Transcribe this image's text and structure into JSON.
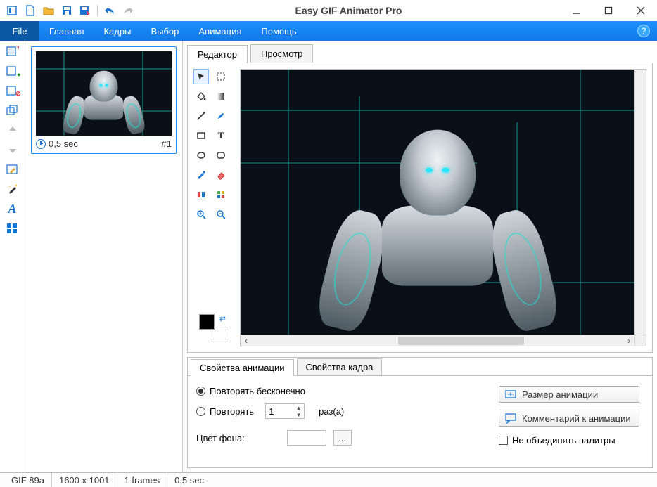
{
  "title": "Easy GIF Animator Pro",
  "ribbon": {
    "file": "File",
    "tabs": [
      "Главная",
      "Кадры",
      "Выбор",
      "Анимация",
      "Помощь"
    ],
    "help_glyph": "?"
  },
  "frames_panel": {
    "frame0": {
      "duration": "0,5 sec",
      "index": "#1"
    }
  },
  "editor": {
    "tabs": {
      "editor": "Редактор",
      "preview": "Просмотр"
    }
  },
  "props": {
    "tabs": {
      "anim": "Свойства анимации",
      "frame": "Свойства кадра"
    },
    "repeat_forever": "Повторять бесконечно",
    "repeat": "Повторять",
    "repeat_value": "1",
    "times": "раз(а)",
    "bg_color_label": "Цвет фона:",
    "ellipsis": "...",
    "btn_size": "Размер анимации",
    "btn_comment": "Комментарий к анимации",
    "chk_merge": "Не объединять палитры"
  },
  "status": {
    "type": "GIF 89a",
    "dims": "1600 x 1001",
    "frames": "1 frames",
    "dur": "0,5 sec"
  }
}
